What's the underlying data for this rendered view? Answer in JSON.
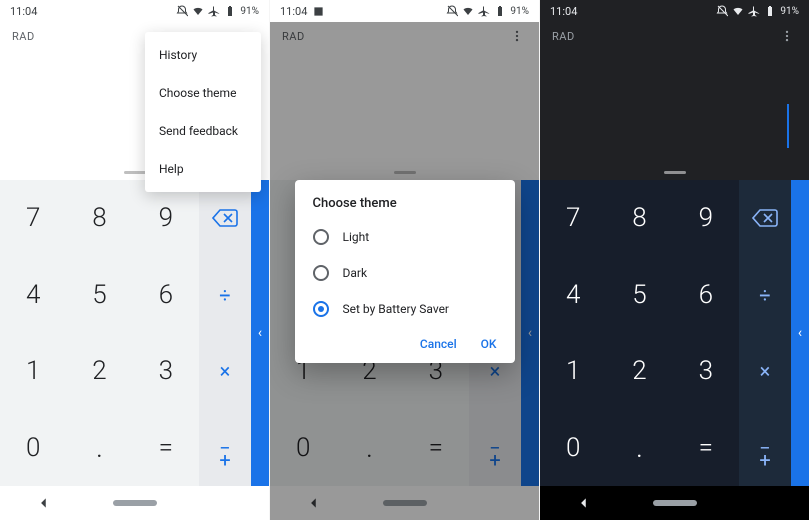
{
  "status": {
    "time": "11:04",
    "battery": "91%"
  },
  "app": {
    "mode_label": "RAD"
  },
  "menu": {
    "items": [
      "History",
      "Choose theme",
      "Send feedback",
      "Help"
    ]
  },
  "dialog": {
    "title": "Choose theme",
    "options": [
      "Light",
      "Dark",
      "Set by Battery Saver"
    ],
    "selected_index": 2,
    "cancel": "Cancel",
    "ok": "OK"
  },
  "keys": {
    "n7": "7",
    "n8": "8",
    "n9": "9",
    "n4": "4",
    "n5": "5",
    "n6": "6",
    "n1": "1",
    "n2": "2",
    "n3": "3",
    "n0": "0",
    "dot": ".",
    "eq": "=",
    "div": "÷",
    "mul": "×",
    "sub": "−",
    "add": "+"
  },
  "side_chevron": "‹"
}
